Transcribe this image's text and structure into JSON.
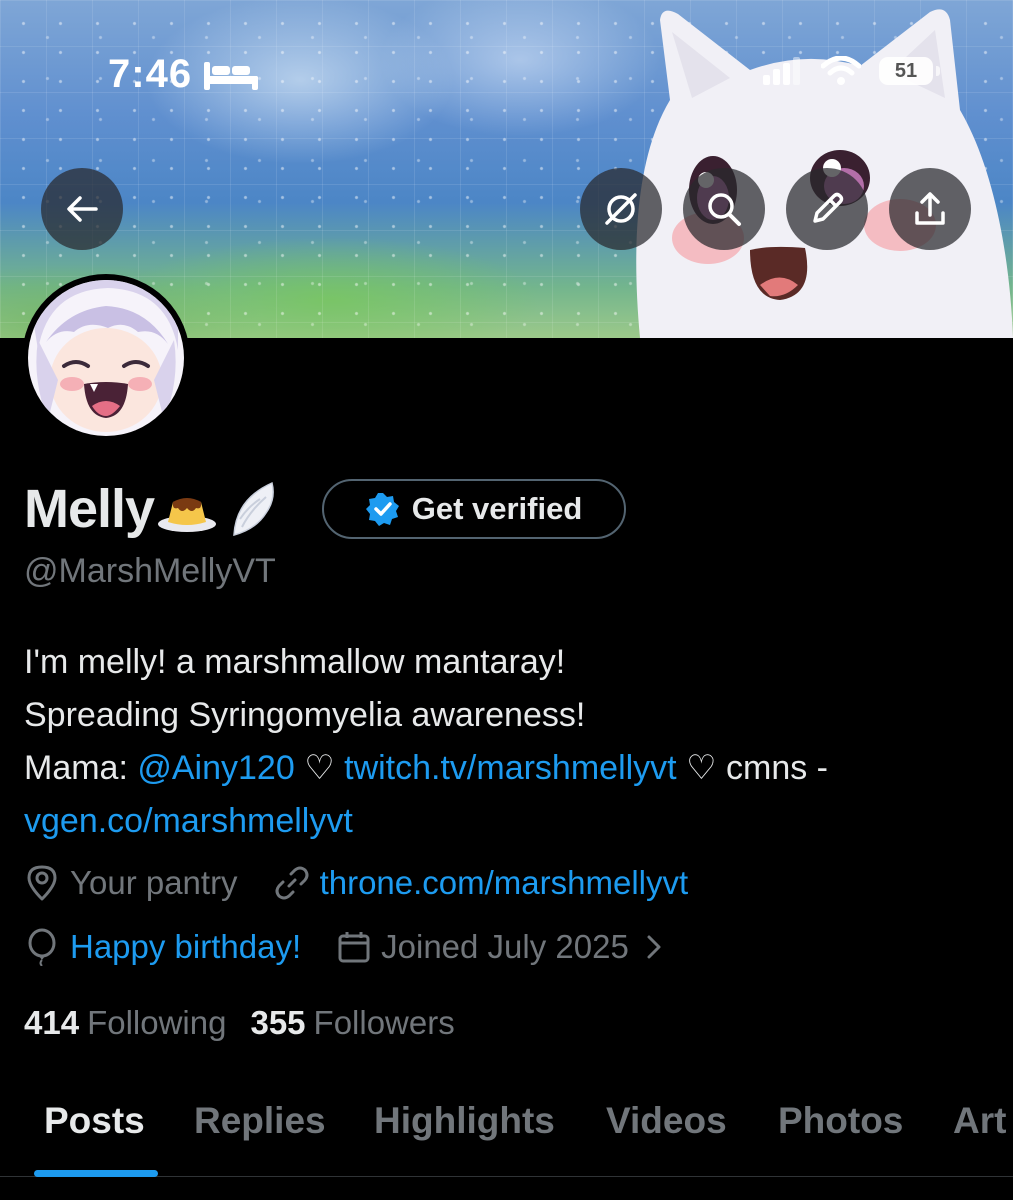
{
  "status_bar": {
    "time": "7:46",
    "battery": "51"
  },
  "header": {
    "icons": [
      "back-arrow-icon",
      "grok-icon",
      "search-icon",
      "pencil-icon",
      "share-icon"
    ]
  },
  "profile": {
    "name": "Melly",
    "name_emojis": [
      "pudding-icon",
      "wing-icon"
    ],
    "get_verified_label": "Get verified",
    "handle": "@MarshMellyVT",
    "bio": {
      "line1": "I'm melly! a marshmallow mantaray!",
      "line2": "Spreading Syringomyelia awareness!",
      "line3_prefix": "Mama: ",
      "mention": "@Ainy120",
      "heart1": " ♡ ",
      "twitch_link": "twitch.tv/marshmellyvt",
      "heart2": " ♡ cmns -",
      "vgen_link": "vgen.co/marshmellyvt"
    },
    "location": "Your pantry",
    "website": "throne.com/marshmellyvt",
    "birthday": "Happy birthday!",
    "joined": "Joined July 2025",
    "following_count": "414",
    "following_label": "Following",
    "followers_count": "355",
    "followers_label": "Followers"
  },
  "tabs": [
    {
      "label": "Posts",
      "active": true
    },
    {
      "label": "Replies",
      "active": false
    },
    {
      "label": "Highlights",
      "active": false
    },
    {
      "label": "Videos",
      "active": false
    },
    {
      "label": "Photos",
      "active": false
    },
    {
      "label": "Art",
      "active": false
    }
  ],
  "colors": {
    "accent": "#1d9bf0",
    "background": "#000000",
    "secondary_text": "#71767b"
  }
}
